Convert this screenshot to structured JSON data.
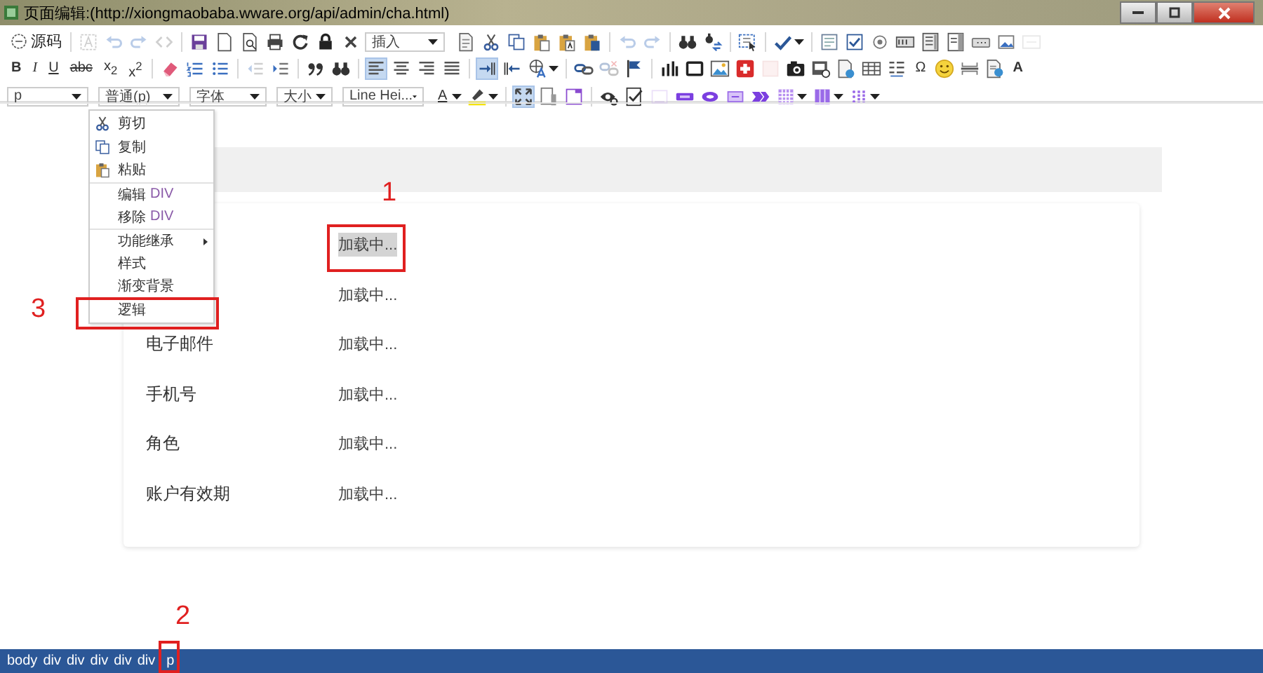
{
  "window": {
    "title": "页面编辑:(http://xiongmaobaba.wware.org/api/admin/cha.html)"
  },
  "toolbar": {
    "rows": [
      {
        "items": [
          {
            "kind": "button",
            "text": "源码"
          },
          {
            "kind": "sep"
          },
          {
            "kind": "icon",
            "disabled": true
          },
          {
            "kind": "icon",
            "disabled": true
          },
          {
            "kind": "icon",
            "disabled": true
          },
          {
            "kind": "icon",
            "disabled": true
          },
          {
            "kind": "sep"
          },
          {
            "kind": "icon"
          },
          {
            "kind": "icon"
          },
          {
            "kind": "icon"
          },
          {
            "kind": "icon"
          },
          {
            "kind": "icon"
          },
          {
            "kind": "icon"
          },
          {
            "kind": "icon"
          },
          {
            "kind": "select",
            "text": "插入"
          },
          {
            "kind": "icon"
          },
          {
            "kind": "icon"
          },
          {
            "kind": "icon"
          },
          {
            "kind": "icon"
          },
          {
            "kind": "icon"
          },
          {
            "kind": "icon"
          },
          {
            "kind": "sep"
          },
          {
            "kind": "icon",
            "disabled": true
          },
          {
            "kind": "icon",
            "disabled": true
          },
          {
            "kind": "sep"
          },
          {
            "kind": "icon"
          },
          {
            "kind": "icon"
          },
          {
            "kind": "sep"
          },
          {
            "kind": "icon"
          },
          {
            "kind": "sep"
          },
          {
            "kind": "icon",
            "dropdown": true
          },
          {
            "kind": "sep"
          },
          {
            "kind": "icon"
          },
          {
            "kind": "icon"
          },
          {
            "kind": "icon"
          },
          {
            "kind": "icon"
          },
          {
            "kind": "icon"
          },
          {
            "kind": "icon"
          },
          {
            "kind": "icon"
          },
          {
            "kind": "icon"
          },
          {
            "kind": "icon",
            "disabled": true
          }
        ]
      },
      {
        "items": [
          {
            "kind": "bold",
            "text": "B"
          },
          {
            "kind": "italic",
            "text": "I"
          },
          {
            "kind": "underline",
            "text": "U"
          },
          {
            "kind": "strike",
            "text": "abc"
          },
          {
            "kind": "glyph",
            "text": "x$_{2}$"
          },
          {
            "kind": "glyph",
            "text": "x$^{2}$"
          },
          {
            "kind": "sep"
          },
          {
            "kind": "icon"
          },
          {
            "kind": "icon"
          },
          {
            "kind": "icon"
          },
          {
            "kind": "sep"
          },
          {
            "kind": "icon",
            "disabled": true
          },
          {
            "kind": "icon"
          },
          {
            "kind": "sep"
          },
          {
            "kind": "icon"
          },
          {
            "kind": "icon"
          },
          {
            "kind": "sep"
          },
          {
            "kind": "icon",
            "active": true
          },
          {
            "kind": "icon"
          },
          {
            "kind": "icon"
          },
          {
            "kind": "icon"
          },
          {
            "kind": "sep"
          },
          {
            "kind": "icon",
            "active": true
          },
          {
            "kind": "icon"
          },
          {
            "kind": "icon",
            "dropdown": true
          },
          {
            "kind": "sep"
          },
          {
            "kind": "icon"
          },
          {
            "kind": "icon",
            "disabled": true
          },
          {
            "kind": "icon"
          },
          {
            "kind": "sep"
          },
          {
            "kind": "icon"
          },
          {
            "kind": "icon"
          },
          {
            "kind": "icon"
          },
          {
            "kind": "icon"
          },
          {
            "kind": "icon",
            "disabled": true
          },
          {
            "kind": "icon"
          },
          {
            "kind": "icon"
          },
          {
            "kind": "icon"
          },
          {
            "kind": "icon"
          },
          {
            "kind": "icon"
          },
          {
            "kind": "glyph",
            "text": "Ω"
          },
          {
            "kind": "icon"
          },
          {
            "kind": "icon"
          },
          {
            "kind": "icon"
          },
          {
            "kind": "bold",
            "text": "A"
          }
        ]
      },
      {
        "items": [
          {
            "kind": "select",
            "text": "p"
          },
          {
            "kind": "select",
            "text": "普通(p)"
          },
          {
            "kind": "select",
            "text": "字体"
          },
          {
            "kind": "select",
            "text": "大小"
          },
          {
            "kind": "select",
            "text": "Line Hei..."
          },
          {
            "kind": "underline",
            "text": "A",
            "dropdown": true
          },
          {
            "kind": "icon",
            "dropdown": true
          },
          {
            "kind": "sep"
          },
          {
            "kind": "icon",
            "active": true
          },
          {
            "kind": "icon"
          },
          {
            "kind": "icon"
          },
          {
            "kind": "sep"
          },
          {
            "kind": "icon"
          },
          {
            "kind": "icon"
          },
          {
            "kind": "icon",
            "disabled": true
          },
          {
            "kind": "icon"
          },
          {
            "kind": "icon"
          },
          {
            "kind": "icon"
          },
          {
            "kind": "icon"
          },
          {
            "kind": "icon",
            "dropdown": true
          },
          {
            "kind": "icon",
            "dropdown": true
          },
          {
            "kind": "icon",
            "dropdown": true
          }
        ]
      }
    ]
  },
  "page": {
    "rows": [
      {
        "value": "加载中...",
        "selected": true
      },
      {
        "value": "加载中...",
        "selected": false
      },
      {
        "label": "电子邮件",
        "value": "加载中...",
        "selected": false
      },
      {
        "label": "手机号",
        "value": "加载中...",
        "selected": false
      },
      {
        "label": "角色",
        "value": "加载中...",
        "selected": false
      },
      {
        "label": "账户有效期",
        "value": "加载中...",
        "selected": false
      }
    ]
  },
  "context_menu": {
    "items": [
      {
        "label": "剪切",
        "kind": "with-icon"
      },
      {
        "label": "复制",
        "kind": "with-icon"
      },
      {
        "label": "粘贴",
        "kind": "with-icon"
      },
      {
        "label": "编辑",
        "tag": "DIV",
        "kind": "plain",
        "separator_before": true
      },
      {
        "label": "移除",
        "tag": "DIV",
        "kind": "plain"
      },
      {
        "label": "功能继承",
        "kind": "plain",
        "separator_before": true,
        "has_submenu": true
      },
      {
        "label": "样式",
        "kind": "plain"
      },
      {
        "label": "渐变背景",
        "kind": "plain"
      },
      {
        "label": "逻辑",
        "kind": "plain"
      }
    ]
  },
  "annotations": [
    {
      "number": "1"
    },
    {
      "number": "2"
    },
    {
      "number": "3"
    }
  ],
  "status_bar": {
    "path": [
      "body",
      "div",
      "div",
      "div",
      "div",
      "div",
      "p"
    ]
  }
}
